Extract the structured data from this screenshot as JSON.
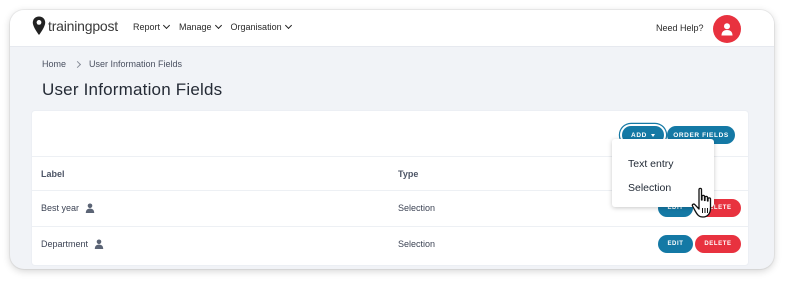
{
  "brand": {
    "name": "trainingpost",
    "accent": "#1479a5",
    "danger": "#e8323f"
  },
  "nav": {
    "items": [
      {
        "label": "Report"
      },
      {
        "label": "Manage"
      },
      {
        "label": "Organisation"
      }
    ],
    "help_label": "Need Help?",
    "avatar_icon": "user-icon"
  },
  "breadcrumb": {
    "home": "Home",
    "current": "User Information Fields"
  },
  "page_title": "User Information Fields",
  "toolbar": {
    "add_label": "ADD",
    "order_label": "ORDER FIELDS"
  },
  "table": {
    "headers": {
      "label": "Label",
      "type": "Type"
    },
    "rows": [
      {
        "label": "Best year",
        "type": "Selection",
        "edit": "EDIT",
        "delete": "DELETE"
      },
      {
        "label": "Department",
        "type": "Selection",
        "edit": "EDIT",
        "delete": "DELETE"
      }
    ]
  },
  "add_menu": {
    "open": true,
    "items": [
      "Text entry",
      "Selection"
    ]
  }
}
